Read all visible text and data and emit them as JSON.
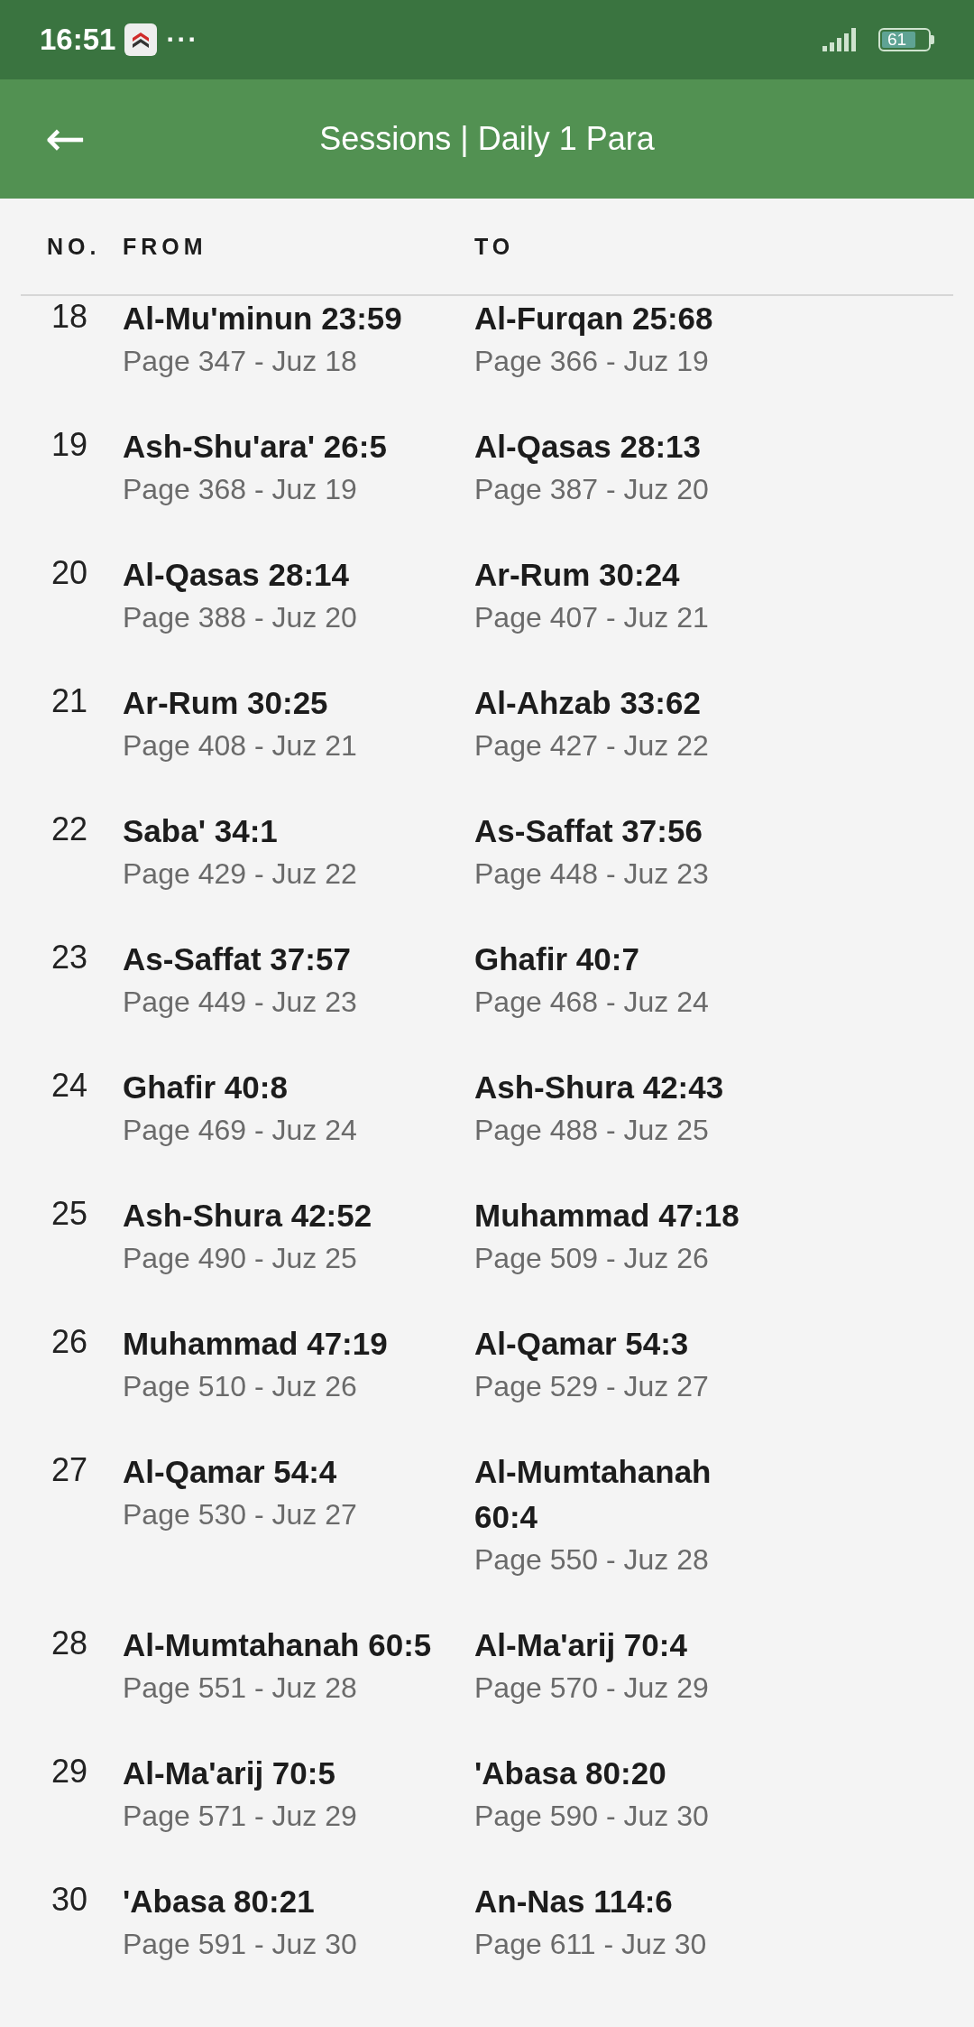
{
  "status_bar": {
    "time": "16:51",
    "more": "···",
    "battery": "61"
  },
  "app_bar": {
    "back": "←",
    "title": "Sessions | Daily 1 Para"
  },
  "table": {
    "columns": [
      "NO.",
      "FROM",
      "TO"
    ],
    "rows": [
      {
        "no": "18",
        "from": "Al-Mu'minun 23:59",
        "from_detail": "Page 347 - Juz 18",
        "to": "Al-Furqan 25:68",
        "to_detail": "Page 366 - Juz 19"
      },
      {
        "no": "19",
        "from": "Ash-Shu'ara' 26:5",
        "from_detail": "Page 368 - Juz 19",
        "to": "Al-Qasas 28:13",
        "to_detail": "Page 387 - Juz 20"
      },
      {
        "no": "20",
        "from": "Al-Qasas 28:14",
        "from_detail": "Page 388 - Juz 20",
        "to": "Ar-Rum 30:24",
        "to_detail": "Page 407 - Juz 21"
      },
      {
        "no": "21",
        "from": "Ar-Rum 30:25",
        "from_detail": "Page 408 - Juz 21",
        "to": "Al-Ahzab 33:62",
        "to_detail": "Page 427 - Juz 22"
      },
      {
        "no": "22",
        "from": "Saba' 34:1",
        "from_detail": "Page 429 - Juz 22",
        "to": "As-Saffat 37:56",
        "to_detail": "Page 448 - Juz 23"
      },
      {
        "no": "23",
        "from": "As-Saffat 37:57",
        "from_detail": "Page 449 - Juz 23",
        "to": "Ghafir 40:7",
        "to_detail": "Page 468 - Juz 24"
      },
      {
        "no": "24",
        "from": "Ghafir 40:8",
        "from_detail": "Page 469 - Juz 24",
        "to": "Ash-Shura 42:43",
        "to_detail": "Page 488 - Juz 25"
      },
      {
        "no": "25",
        "from": "Ash-Shura 42:52",
        "from_detail": "Page 490 - Juz 25",
        "to": "Muhammad 47:18",
        "to_detail": "Page 509 - Juz 26"
      },
      {
        "no": "26",
        "from": "Muhammad 47:19",
        "from_detail": "Page 510 - Juz 26",
        "to": "Al-Qamar 54:3",
        "to_detail": "Page 529 - Juz 27"
      },
      {
        "no": "27",
        "from": "Al-Qamar 54:4",
        "from_detail": "Page 530 - Juz 27",
        "to": "Al-Mumtahanah 60:4",
        "to_detail": "Page 550 - Juz 28"
      },
      {
        "no": "28",
        "from": "Al-Mumtahanah 60:5",
        "from_detail": "Page 551 - Juz 28",
        "to": "Al-Ma'arij 70:4",
        "to_detail": "Page 570 - Juz 29"
      },
      {
        "no": "29",
        "from": "Al-Ma'arij 70:5",
        "from_detail": "Page 571 - Juz 29",
        "to": "'Abasa 80:20",
        "to_detail": "Page 590 - Juz 30"
      },
      {
        "no": "30",
        "from": "'Abasa 80:21",
        "from_detail": "Page 591 - Juz 30",
        "to": "An-Nas 114:6",
        "to_detail": "Page 611 - Juz 30"
      }
    ]
  }
}
